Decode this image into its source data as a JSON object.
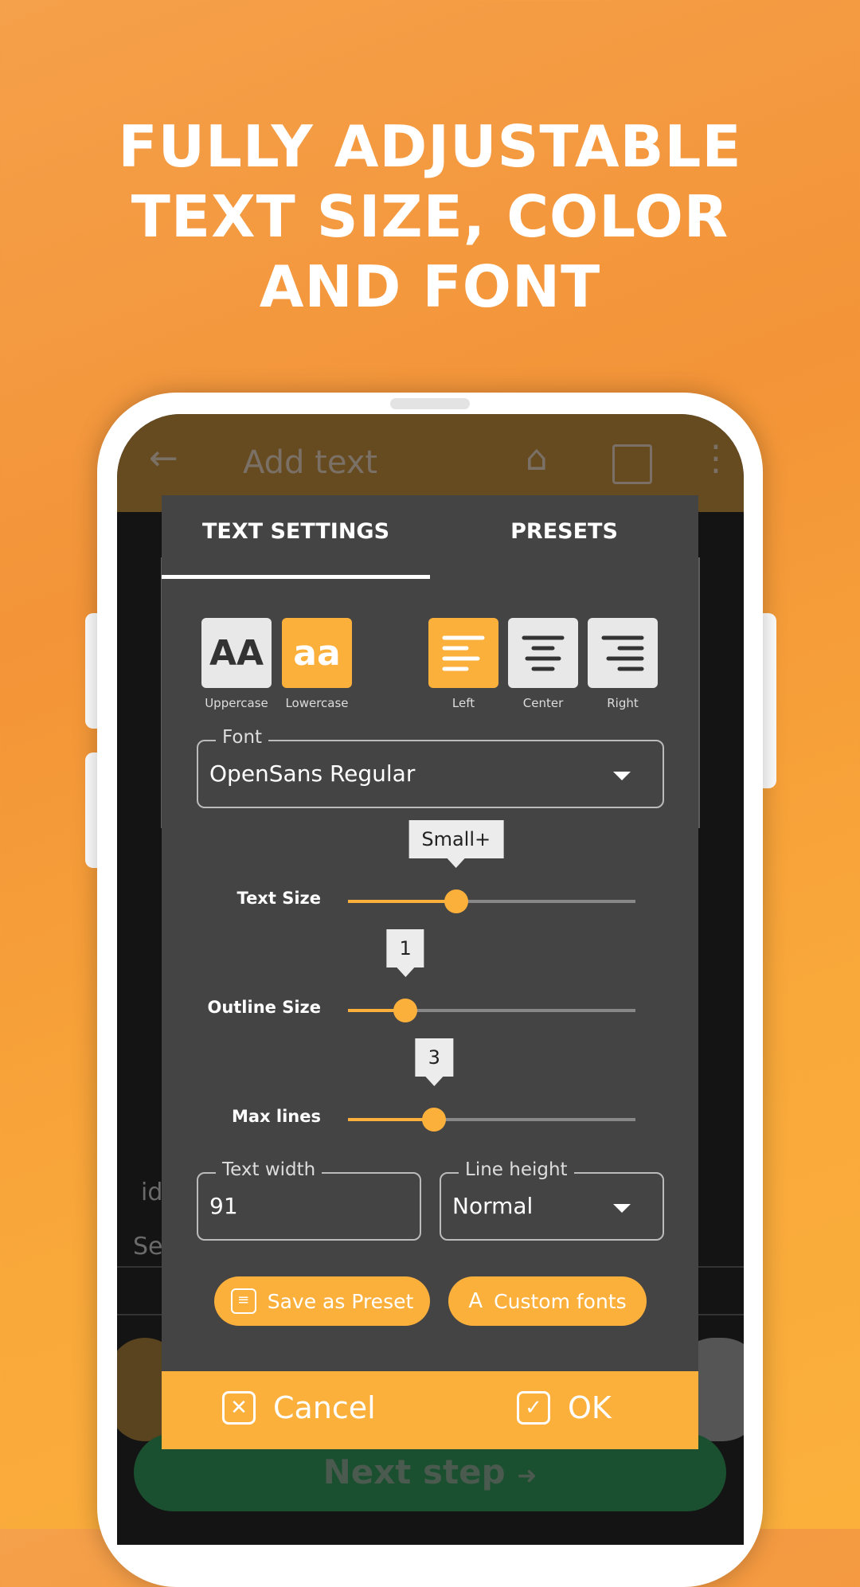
{
  "headline": [
    "FULLY ADJUSTABLE",
    "TEXT SIZE, COLOR",
    "AND FONT"
  ],
  "app": {
    "title": "Add text",
    "back_icon": "arrow-left-icon",
    "home_icon": "home-icon",
    "tablet_icon": "tablet-icon",
    "menu_icon": "more-vert-icon",
    "next_step": "Next step"
  },
  "dialog": {
    "tabs": [
      {
        "label": "TEXT SETTINGS",
        "active": true
      },
      {
        "label": "PRESETS",
        "active": false
      }
    ],
    "case": [
      {
        "label": "Uppercase",
        "glyph": "AA",
        "selected": false
      },
      {
        "label": "Lowercase",
        "glyph": "aa",
        "selected": true
      }
    ],
    "align": [
      {
        "label": "Left",
        "selected": true
      },
      {
        "label": "Center",
        "selected": false
      },
      {
        "label": "Right",
        "selected": false
      }
    ],
    "font": {
      "label": "Font",
      "value": "OpenSans Regular"
    },
    "sliders": [
      {
        "label": "Text Size",
        "tooltip": "Small+",
        "fraction": 0.376
      },
      {
        "label": "Outline Size",
        "tooltip": "1",
        "fraction": 0.2
      },
      {
        "label": "Max lines",
        "tooltip": "3",
        "fraction": 0.3
      }
    ],
    "text_width": {
      "label": "Text width",
      "value": "91"
    },
    "line_height": {
      "label": "Line height",
      "value": "Normal"
    },
    "save_preset": "Save as Preset",
    "custom_fonts": "Custom fonts",
    "cancel": "Cancel",
    "ok": "OK"
  },
  "colors": {
    "accent": "#fbb03b",
    "dialog": "#444444",
    "appbar": "#674b20",
    "next": "#1a4f2f"
  }
}
